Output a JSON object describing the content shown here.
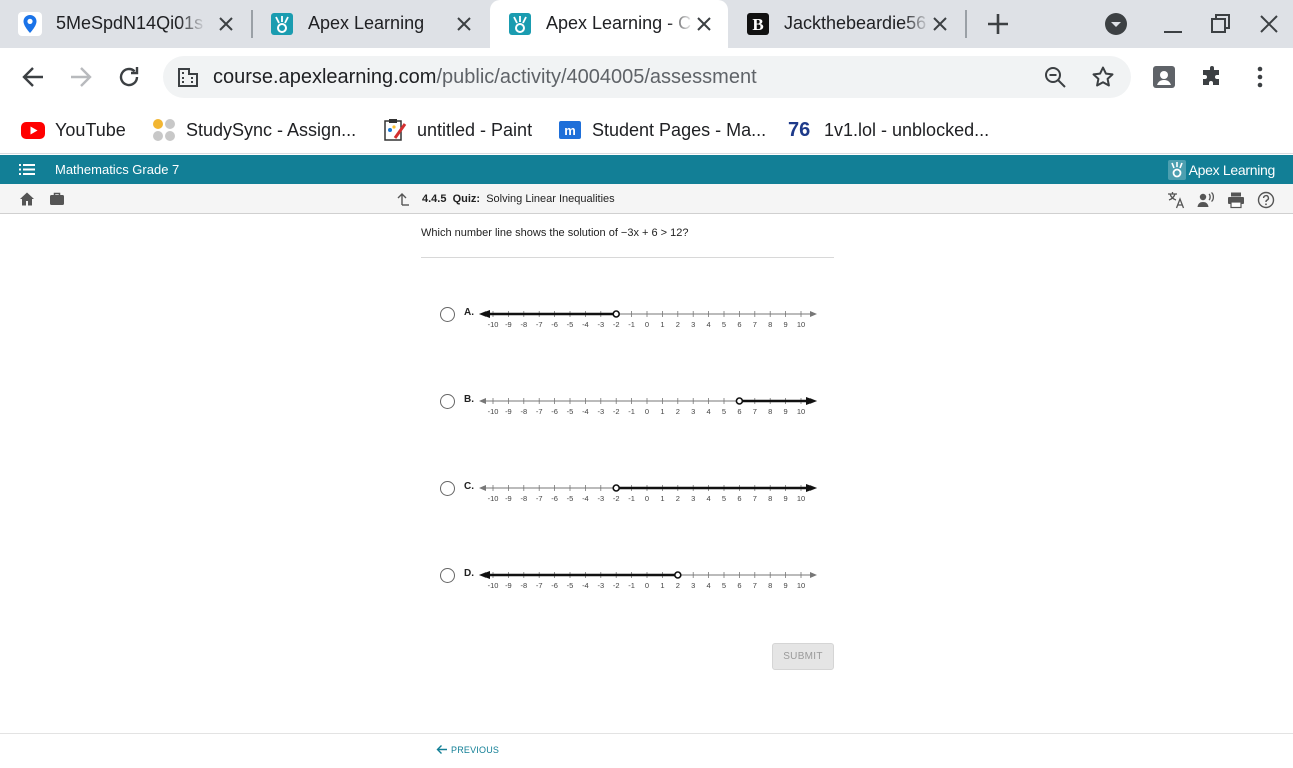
{
  "tabs": [
    {
      "title": "5MeSpdN14Qi01s",
      "active": false
    },
    {
      "title": "Apex Learning",
      "active": false
    },
    {
      "title": "Apex Learning - C",
      "active": true
    },
    {
      "title": "Jackthebeardie56",
      "active": false
    }
  ],
  "omnibox": {
    "host": "course.apexlearning.com",
    "path": "/public/activity/4004005/assessment"
  },
  "bookmarks": [
    {
      "label": "YouTube",
      "icon": "youtube-icon"
    },
    {
      "label": "StudySync - Assign...",
      "icon": "studysync-icon"
    },
    {
      "label": "untitled - Paint",
      "icon": "paint-icon"
    },
    {
      "label": "Student Pages - Ma...",
      "icon": "student-pages-icon"
    },
    {
      "label": "1v1.lol - unblocked...",
      "icon": "1v1-icon",
      "badge": "76"
    }
  ],
  "app": {
    "course": "Mathematics Grade 7",
    "logo": "Apex Learning"
  },
  "breadcrumb": {
    "number": "4.4.5",
    "type": "Quiz:",
    "title": "Solving Linear Inequalities"
  },
  "question": {
    "text": "Which number line shows the solution of −3x + 6 > 12?"
  },
  "choices": [
    {
      "letter": "A.",
      "point": -2,
      "direction": "left",
      "closed": false
    },
    {
      "letter": "B.",
      "point": 6,
      "direction": "right",
      "closed": false
    },
    {
      "letter": "C.",
      "point": -2,
      "direction": "right",
      "closed": false
    },
    {
      "letter": "D.",
      "point": 2,
      "direction": "left",
      "closed": false
    }
  ],
  "number_line": {
    "min": -10,
    "max": 10,
    "step": 1
  },
  "buttons": {
    "submit": "SUBMIT",
    "previous": "PREVIOUS"
  },
  "colors": {
    "apex_teal": "#127f96",
    "tab_strip": "#dee1e6"
  }
}
